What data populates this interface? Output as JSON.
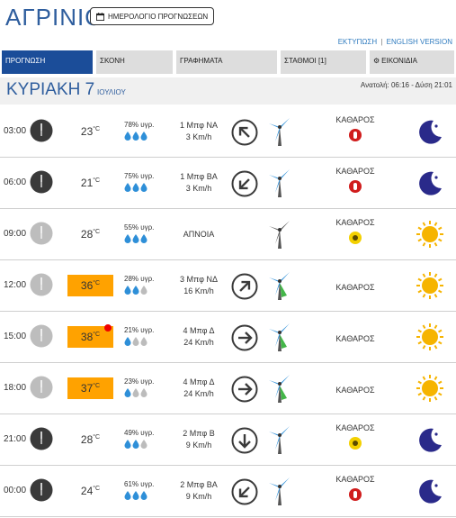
{
  "city": "ΑΓΡΙΝΙΟ",
  "calendar_button": "ΗΜΕΡΟΛΟΓΙΟ ΠΡΟΓΝΩΣΕΩΝ",
  "links": {
    "print": "ΕΚΤΥΠΩΣΗ",
    "separator": "|",
    "english": "ENGLISH VERSION"
  },
  "tabs": [
    {
      "label": "ΠΡΟΓΝΩΣΗ",
      "active": true
    },
    {
      "label": "ΣΚΟΝΗ",
      "active": false
    },
    {
      "label": "ΓΡΑΦΗΜΑΤΑ",
      "active": false
    },
    {
      "label": "ΣΤΑΘΜΟΙ [1]",
      "active": false
    },
    {
      "label": "ΕΙΚΟΝΙΔΙΑ",
      "active": false
    }
  ],
  "day": {
    "name": "ΚΥΡΙΑΚΗ 7",
    "month": "ΙΟΥΛΙΟΥ",
    "sun": "Ανατολή: 06:16 - Δύση 21:01"
  },
  "colors": {
    "brand_blue": "#1b4d99",
    "hot": "#ffa200",
    "drop": "#2e8fd8",
    "turbine": "#2e8fd8",
    "turbine_green": "#44b649",
    "sun": "#f6b400",
    "moon": "#2a2a8a"
  },
  "rows": [
    {
      "time": "03:00",
      "night_clock": true,
      "temp": "23",
      "unit": "°C",
      "hot": false,
      "hot_dot": false,
      "humidity": "78% υγρ.",
      "drops": 3,
      "wind_line1": "1 Μπφ ΝΑ",
      "wind_line2": "3 Km/h",
      "wind_dir_deg": 315,
      "turbine": "blue",
      "condition": "ΚΑΘΑΡΟΣ",
      "badge": "red",
      "icon": "moon-icon"
    },
    {
      "time": "06:00",
      "night_clock": true,
      "temp": "21",
      "unit": "°C",
      "hot": false,
      "hot_dot": false,
      "humidity": "75% υγρ.",
      "drops": 3,
      "wind_line1": "1 Μπφ ΒΑ",
      "wind_line2": "3 Km/h",
      "wind_dir_deg": 225,
      "turbine": "blue",
      "condition": "ΚΑΘΑΡΟΣ",
      "badge": "red",
      "icon": "moon-icon"
    },
    {
      "time": "09:00",
      "night_clock": false,
      "temp": "28",
      "unit": "°C",
      "hot": false,
      "hot_dot": false,
      "humidity": "55% υγρ.",
      "drops": 3,
      "wind_line1": "ΑΠΝΟΙΑ",
      "wind_line2": "",
      "wind_dir_deg": null,
      "turbine": "gray",
      "condition": "ΚΑΘΑΡΟΣ",
      "badge": "yellow",
      "icon": "sun-icon"
    },
    {
      "time": "12:00",
      "night_clock": false,
      "temp": "36",
      "unit": "°C",
      "hot": true,
      "hot_dot": false,
      "humidity": "28% υγρ.",
      "drops": 2,
      "wind_line1": "3 Μπφ ΝΔ",
      "wind_line2": "16 Km/h",
      "wind_dir_deg": 45,
      "turbine": "green",
      "condition": "ΚΑΘΑΡΟΣ",
      "badge": "",
      "icon": "sun-icon"
    },
    {
      "time": "15:00",
      "night_clock": false,
      "temp": "38",
      "unit": "°C",
      "hot": true,
      "hot_dot": true,
      "humidity": "21% υγρ.",
      "drops": 1,
      "wind_line1": "4 Μπφ Δ",
      "wind_line2": "24 Km/h",
      "wind_dir_deg": 90,
      "turbine": "green",
      "condition": "ΚΑΘΑΡΟΣ",
      "badge": "",
      "icon": "sun-icon"
    },
    {
      "time": "18:00",
      "night_clock": false,
      "temp": "37",
      "unit": "°C",
      "hot": true,
      "hot_dot": false,
      "humidity": "23% υγρ.",
      "drops": 1,
      "wind_line1": "4 Μπφ Δ",
      "wind_line2": "24 Km/h",
      "wind_dir_deg": 90,
      "turbine": "green",
      "condition": "ΚΑΘΑΡΟΣ",
      "badge": "",
      "icon": "sun-icon"
    },
    {
      "time": "21:00",
      "night_clock": true,
      "temp": "28",
      "unit": "°C",
      "hot": false,
      "hot_dot": false,
      "humidity": "49% υγρ.",
      "drops": 2,
      "wind_line1": "2 Μπφ Β",
      "wind_line2": "9 Km/h",
      "wind_dir_deg": 180,
      "turbine": "blue",
      "condition": "ΚΑΘΑΡΟΣ",
      "badge": "yellow",
      "icon": "moon-icon"
    },
    {
      "time": "00:00",
      "night_clock": true,
      "temp": "24",
      "unit": "°C",
      "hot": false,
      "hot_dot": false,
      "humidity": "61% υγρ.",
      "drops": 3,
      "wind_line1": "2 Μπφ ΒΑ",
      "wind_line2": "9 Km/h",
      "wind_dir_deg": 225,
      "turbine": "blue",
      "condition": "ΚΑΘΑΡΟΣ",
      "badge": "red",
      "icon": "moon-icon"
    }
  ]
}
